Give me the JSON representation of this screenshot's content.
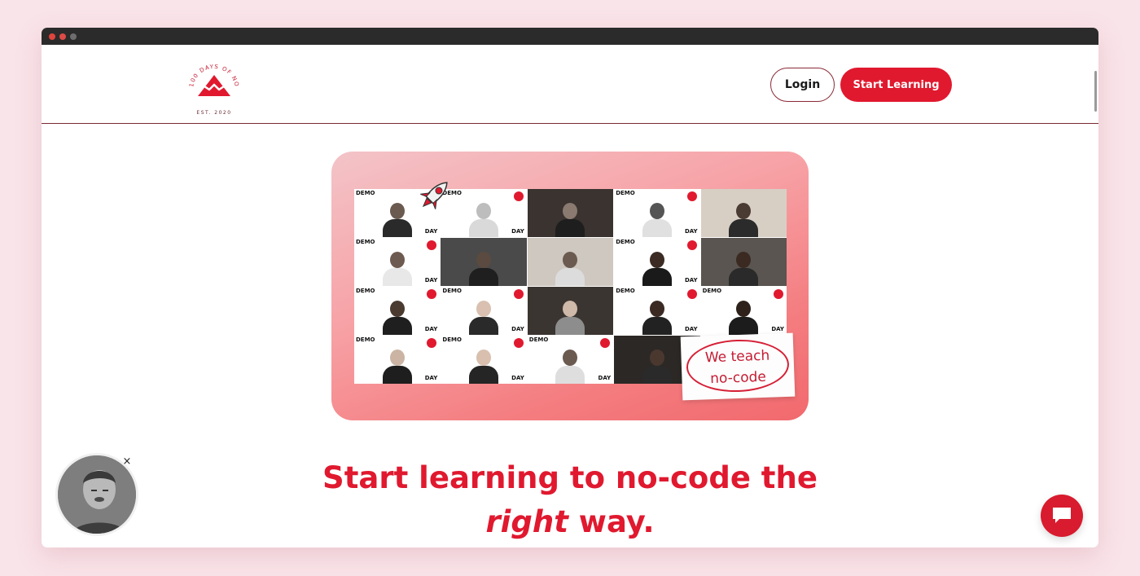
{
  "brand": {
    "logo_text_top": "100 DAYS OF NO CODE",
    "logo_text_bottom": "EST. 2020",
    "accent_color": "#e0192f"
  },
  "nav": {
    "login_label": "Login",
    "start_label": "Start Learning"
  },
  "hero": {
    "sticky_line1": "We teach",
    "sticky_line2": "no-code",
    "tile_demo": "DEMO",
    "tile_day": "DAY",
    "tile_100": "100"
  },
  "headline": {
    "line1": "Start learning to no-code the",
    "line2_emph": "right",
    "line2_rest": " way."
  },
  "widgets": {
    "close_icon": "×",
    "chat_icon": "chat-bubble-icon",
    "avatar_icon": "video-avatar"
  }
}
